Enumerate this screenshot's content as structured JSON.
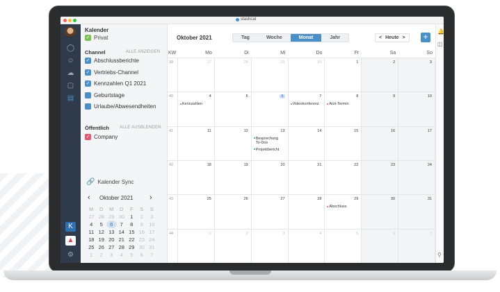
{
  "window": {
    "title": "stashcat"
  },
  "sidebar": {
    "calendar_heading": "Kalender",
    "private_label": "Privat",
    "channel_heading": "Channel",
    "channel_action": "ALLE ANZEIGEN",
    "channels": [
      {
        "label": "Abschlussberichte",
        "checked": true,
        "color": "#4a90c8"
      },
      {
        "label": "Vertriebs-Channel",
        "checked": true,
        "color": "#4a90c8"
      },
      {
        "label": "Kennzahlen Q1 2021",
        "checked": true,
        "color": "#4a90c8"
      },
      {
        "label": "Geburtstage",
        "checked": false,
        "color": "#4a90c8"
      },
      {
        "label": "Urlaube/Abwesendheiten",
        "checked": false,
        "color": "#4a90c8"
      }
    ],
    "public_heading": "Öffentlich",
    "public_action": "ALLE AUSBLENDEN",
    "public_items": [
      {
        "label": "Company",
        "checked": true,
        "color": "#e05a6b"
      }
    ],
    "sync_label": "Kalender Sync",
    "mini_month": "Oktober 2021",
    "mini_weekdays": [
      "M",
      "D",
      "M",
      "D",
      "F",
      "S",
      "S"
    ],
    "mini_days": [
      [
        "27",
        "28",
        "29",
        "30",
        "1",
        "2",
        "3"
      ],
      [
        "4",
        "5",
        "6",
        "7",
        "8",
        "9",
        "10"
      ],
      [
        "11",
        "12",
        "13",
        "14",
        "15",
        "16",
        "17"
      ],
      [
        "18",
        "19",
        "20",
        "21",
        "22",
        "23",
        "24"
      ],
      [
        "25",
        "26",
        "27",
        "28",
        "29",
        "30",
        "31"
      ],
      [
        "1",
        "2",
        "3",
        "4",
        "5",
        "6",
        "7"
      ]
    ]
  },
  "toolbar": {
    "month_label": "Oktober 2021",
    "views": [
      "Tag",
      "Woche",
      "Monat",
      "Jahr"
    ],
    "active_view": "Monat",
    "today_label": "Heute",
    "prev": "<",
    "next": ">",
    "add": "+"
  },
  "calendar": {
    "headers": [
      "KW",
      "Mo",
      "Di",
      "Mi",
      "Do",
      "Fr",
      "Sa",
      "So"
    ],
    "weeks": [
      {
        "kw": "39",
        "days": [
          "27",
          "28",
          "29",
          "30",
          "1",
          "2",
          "3"
        ]
      },
      {
        "kw": "40",
        "days": [
          "4",
          "5",
          "6",
          "7",
          "8",
          "9",
          "10"
        ]
      },
      {
        "kw": "41",
        "days": [
          "11",
          "12",
          "13",
          "14",
          "15",
          "16",
          "17"
        ]
      },
      {
        "kw": "42",
        "days": [
          "18",
          "19",
          "20",
          "21",
          "22",
          "23",
          "24"
        ]
      },
      {
        "kw": "43",
        "days": [
          "25",
          "26",
          "27",
          "28",
          "29",
          "30",
          "31"
        ]
      },
      {
        "kw": "44",
        "days": [
          "1",
          "2",
          "3",
          "4",
          "5",
          "6",
          "7"
        ]
      }
    ],
    "events": [
      {
        "week": 1,
        "day": 0,
        "label": "Kennzahlen",
        "color": "#4a90c8"
      },
      {
        "week": 1,
        "day": 3,
        "label": "Videokonferenz",
        "color": "#4a90c8"
      },
      {
        "week": 1,
        "day": 4,
        "label": "Arzt-Termin",
        "color": "#e05a6b"
      },
      {
        "week": 2,
        "day": 2,
        "label": "Besprechung To-Dos",
        "color": "#3aa76d"
      },
      {
        "week": 2,
        "day": 2,
        "label": "Projektbericht",
        "color": "#3aa76d"
      },
      {
        "week": 4,
        "day": 4,
        "label": "Abschluss",
        "color": "#e05a6b"
      }
    ]
  }
}
